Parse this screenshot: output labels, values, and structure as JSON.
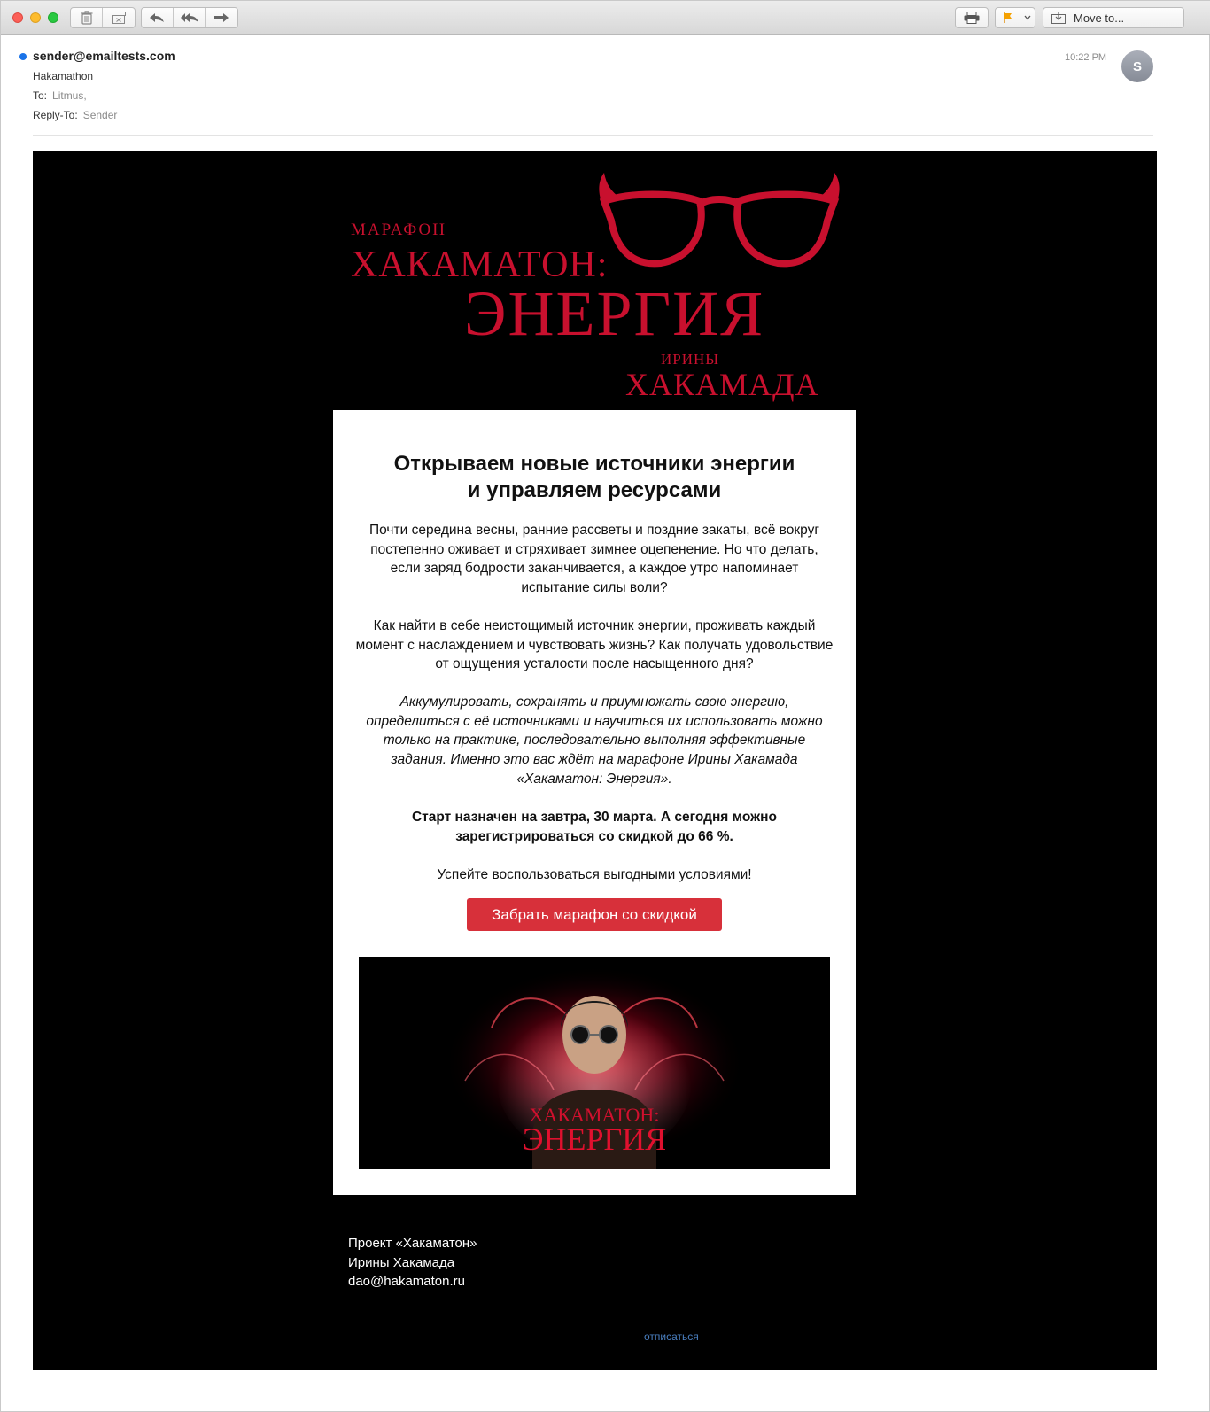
{
  "toolbar": {
    "move_to_label": "Move to..."
  },
  "header": {
    "sender": "sender@emailtests.com",
    "subject": "Hakamathon",
    "to_label": "To:",
    "to_value": "Litmus,",
    "reply_to_label": "Reply-To:",
    "reply_to_value": "Sender",
    "time": "10:22 PM",
    "avatar_initial": "S"
  },
  "email": {
    "logo": {
      "line1": "МАРАФОН",
      "line2": "ХАКАМАТОН:",
      "line3": "ЭНЕРГИЯ",
      "line4": "ИРИНЫ",
      "line5": "ХАКАМАДА"
    },
    "heading_line1": "Открываем новые источники энергии",
    "heading_line2": "и управляем ресурсами",
    "paragraph1": "Почти середина весны, ранние рассветы и поздние закаты, всё вокруг постепенно оживает и стряхивает зимнее оцепенение. Но что делать, если заряд бодрости заканчивается, а каждое утро напоминает испытание силы воли?",
    "paragraph2": "Как найти в себе неистощимый источник энергии, проживать каждый момент с наслаждением и чувствовать жизнь? Как получать удовольствие от ощущения усталости после насыщенного дня?",
    "paragraph3": "Аккумулировать, сохранять и приумножать свою энергию, определиться с её источниками и научиться их использовать можно только на практике, последовательно выполняя эффективные задания. Именно это вас ждёт на марафоне Ирины Хакамада «Хакаматон: Энергия».",
    "paragraph4": "Старт назначен на завтра, 30 марта. А сегодня можно зарегистрироваться со скидкой до 66 %.",
    "paragraph5": "Успейте воспользоваться выгодными условиями!",
    "cta_label": "Забрать марафон со скидкой",
    "banner": {
      "line1": "ХАКАМАТОН:",
      "line2": "ЭНЕРГИЯ"
    },
    "footer_line1": "Проект «Хакаматон»",
    "footer_line2": "Ирины Хакамада",
    "footer_line3": "dao@hakamaton.ru",
    "unsubscribe": "отписаться"
  },
  "colors": {
    "brand_red": "#c8102e",
    "cta_red": "#d7303a",
    "unread_dot": "#1a73e8"
  }
}
